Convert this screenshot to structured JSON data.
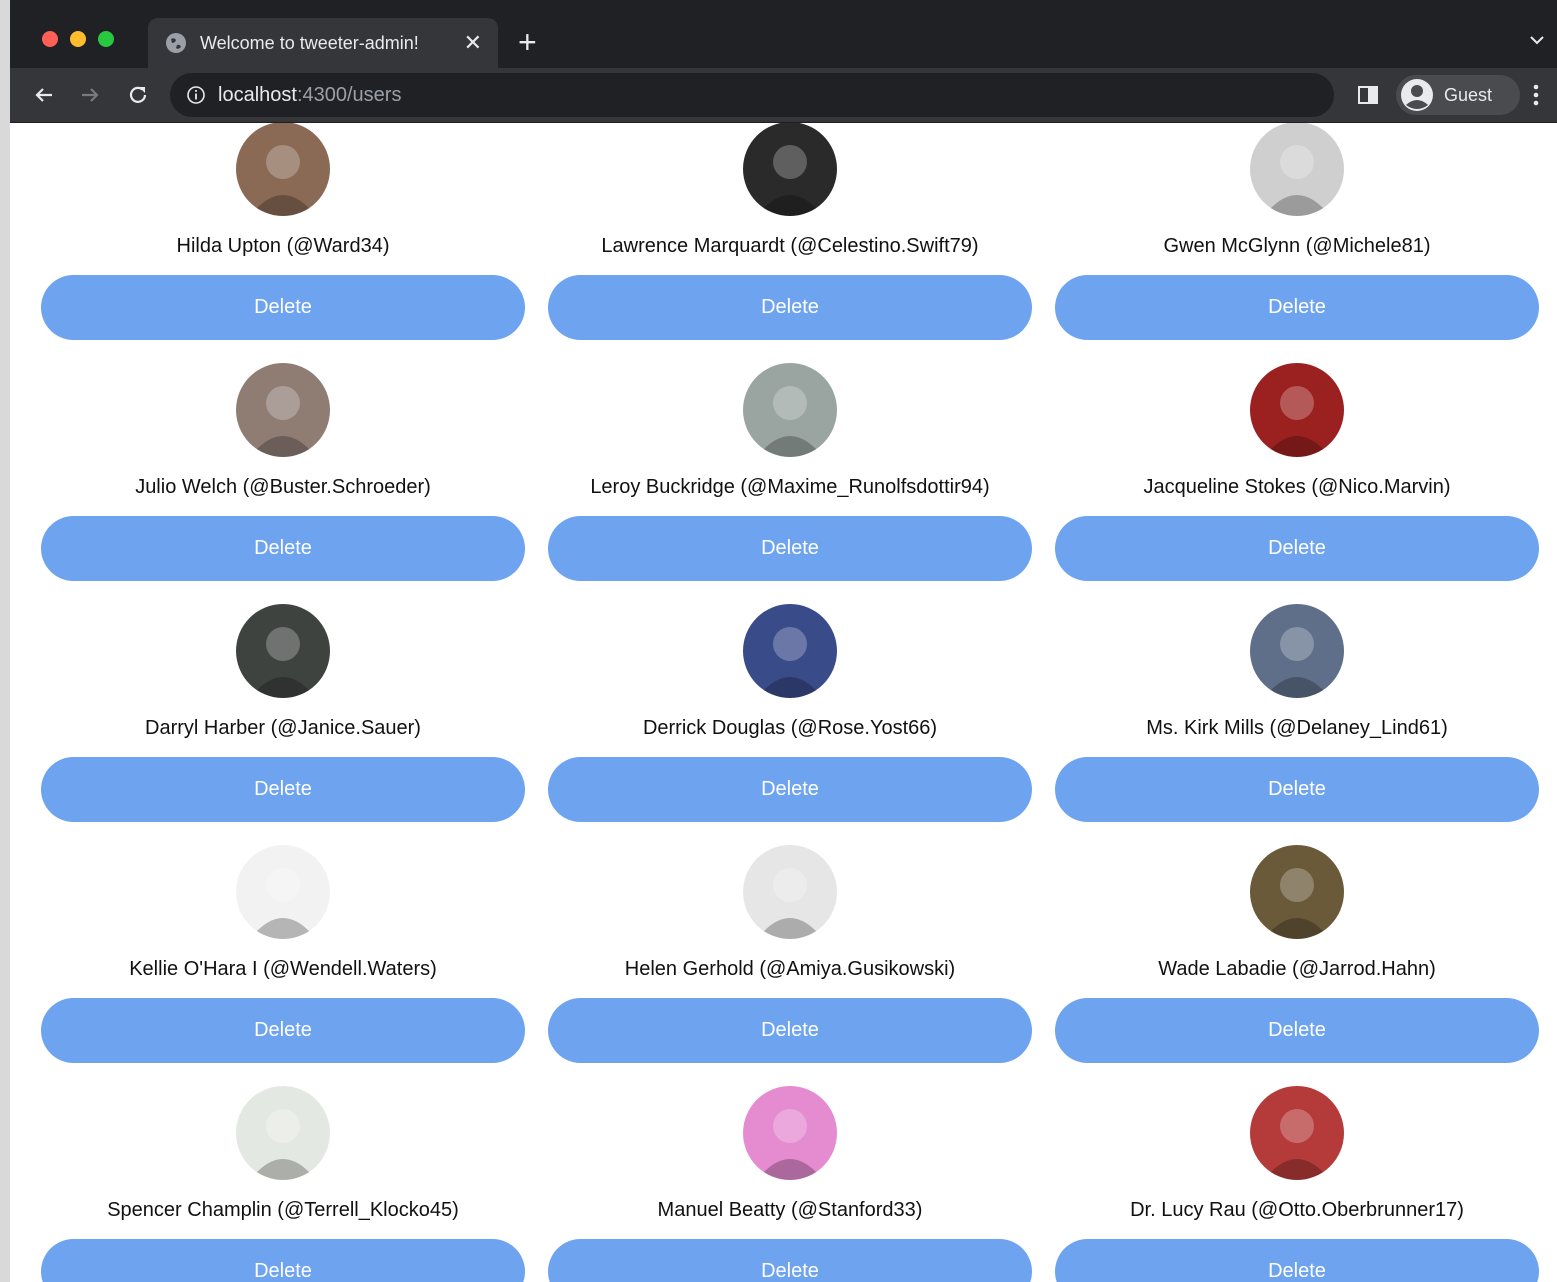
{
  "browser": {
    "tab_title": "Welcome to tweeter-admin!",
    "url_host": "localhost",
    "url_rest": ":4300/users",
    "profile_label": "Guest"
  },
  "users": [
    {
      "label": "Hilda Upton (@Ward34)",
      "avatar_color": "#8a6a55"
    },
    {
      "label": "Lawrence Marquardt (@Celestino.Swift79)",
      "avatar_color": "#2a2a2a"
    },
    {
      "label": "Gwen McGlynn (@Michele81)",
      "avatar_color": "#cfcfcf"
    },
    {
      "label": "Julio Welch (@Buster.Schroeder)",
      "avatar_color": "#8f7d74"
    },
    {
      "label": "Leroy Buckridge (@Maxime_Runolfsdottir94)",
      "avatar_color": "#9aa5a2"
    },
    {
      "label": "Jacqueline Stokes (@Nico.Marvin)",
      "avatar_color": "#9b2020"
    },
    {
      "label": "Darryl Harber (@Janice.Sauer)",
      "avatar_color": "#3f4340"
    },
    {
      "label": "Derrick Douglas (@Rose.Yost66)",
      "avatar_color": "#3a4b8a"
    },
    {
      "label": "Ms. Kirk Mills (@Delaney_Lind61)",
      "avatar_color": "#5f6f8a"
    },
    {
      "label": "Kellie O'Hara I (@Wendell.Waters)",
      "avatar_color": "#f2f2f2"
    },
    {
      "label": "Helen Gerhold (@Amiya.Gusikowski)",
      "avatar_color": "#e6e6e6"
    },
    {
      "label": "Wade Labadie (@Jarrod.Hahn)",
      "avatar_color": "#6a5a3a"
    },
    {
      "label": "Spencer Champlin (@Terrell_Klocko45)",
      "avatar_color": "#e4e8e2"
    },
    {
      "label": "Manuel Beatty (@Stanford33)",
      "avatar_color": "#e58bd0"
    },
    {
      "label": "Dr. Lucy Rau (@Otto.Oberbrunner17)",
      "avatar_color": "#b53a3a"
    }
  ],
  "delete_label": "Delete",
  "colors": {
    "button": "#6ea3f0",
    "chrome_dark": "#202124",
    "chrome_toolbar": "#35363a"
  }
}
